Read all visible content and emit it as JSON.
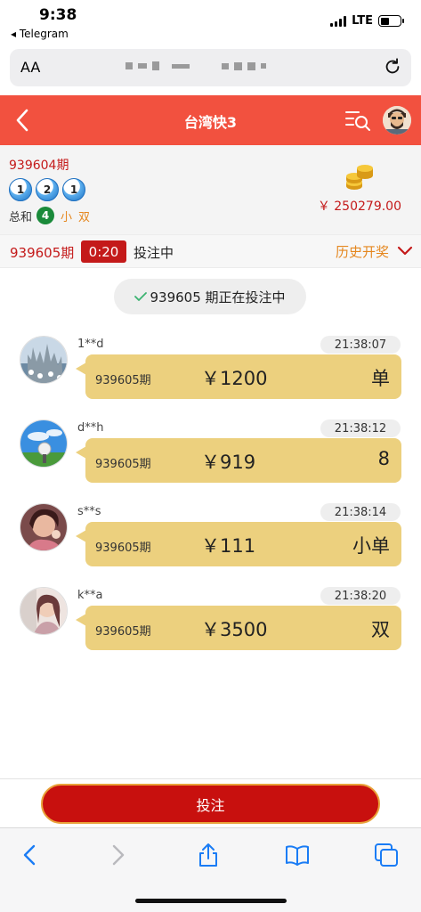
{
  "status_bar": {
    "time": "9:38",
    "back_app": "◂ Telegram",
    "network": "LTE",
    "battery_level": 0.45
  },
  "browser": {
    "text_size_label": "AA"
  },
  "header": {
    "title": "台湾快3",
    "back_icon": "chevron-left-icon",
    "search_icon": "list-search-icon",
    "avatar_icon": "user-avatar-icon",
    "color": "#f2513f"
  },
  "last_draw": {
    "period": "939604期",
    "balls": [
      "1",
      "2",
      "1"
    ],
    "sum_label": "总和",
    "sum_value": "4",
    "size_tag": "小",
    "parity_tag": "双",
    "balance": "￥ 250279.00"
  },
  "current": {
    "period": "939605期",
    "timer": "0:20",
    "state": "投注中",
    "history_label": "历史开奖"
  },
  "notice": {
    "text": "939605 期正在投注中"
  },
  "bets": [
    {
      "user": "1**d",
      "time": "21:38:07",
      "period": "939605期",
      "amount": "￥1200",
      "choice": "单"
    },
    {
      "user": "d**h",
      "time": "21:38:12",
      "period": "939605期",
      "amount": "￥919",
      "choice": "8"
    },
    {
      "user": "s**s",
      "time": "21:38:14",
      "period": "939605期",
      "amount": "￥111",
      "choice": "小单"
    },
    {
      "user": "k**a",
      "time": "21:38:20",
      "period": "939605期",
      "amount": "￥3500",
      "choice": "双"
    }
  ],
  "bet_button": {
    "label": "投注"
  },
  "colors": {
    "accent_red": "#c8100e",
    "bubble": "#ecd07e",
    "orange": "#e5871f",
    "safari_blue": "#1a7cf5"
  }
}
